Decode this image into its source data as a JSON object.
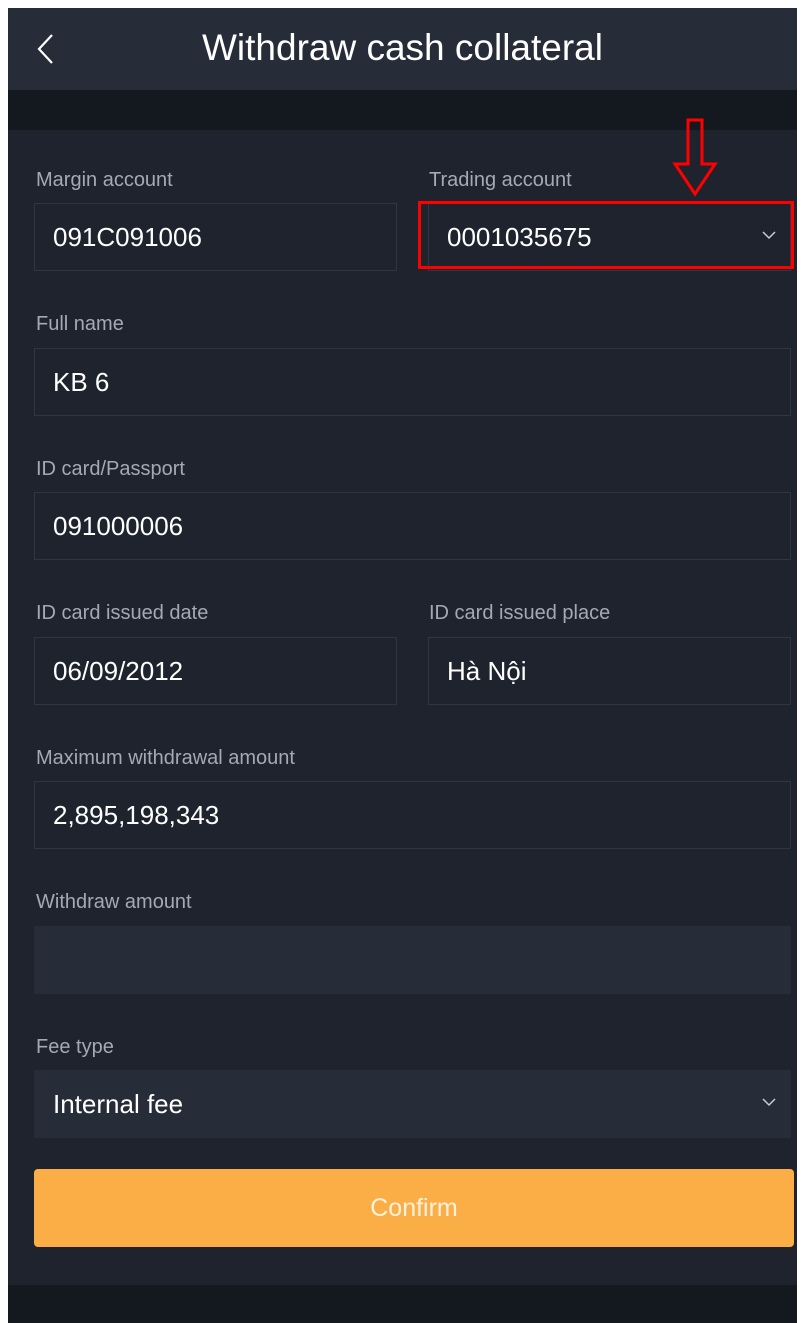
{
  "header": {
    "title": "Withdraw cash collateral",
    "back_icon": "chevron-left-icon"
  },
  "form": {
    "margin_account": {
      "label": "Margin account",
      "value": "091C091006"
    },
    "trading_account": {
      "label": "Trading account",
      "value": "0001035675",
      "icon": "chevron-down-icon"
    },
    "full_name": {
      "label": "Full name",
      "value": "KB 6"
    },
    "id_card": {
      "label": "ID card/Passport",
      "value": "091000006"
    },
    "issued_date": {
      "label": "ID card issued date",
      "value": "06/09/2012"
    },
    "issued_place": {
      "label": "ID card issued place",
      "value": "Hà Nội"
    },
    "max_withdrawal": {
      "label": "Maximum withdrawal amount",
      "value": "2,895,198,343"
    },
    "withdraw_amount": {
      "label": "Withdraw amount",
      "value": ""
    },
    "fee_type": {
      "label": "Fee type",
      "value": "Internal fee",
      "icon": "chevron-down-icon"
    }
  },
  "confirm_label": "Confirm",
  "annotation": {
    "color": "#ff0000",
    "arrow_icon": "down-arrow-icon"
  },
  "colors": {
    "accent": "#fcae46",
    "background": "#1e232e",
    "header": "#262c38"
  }
}
